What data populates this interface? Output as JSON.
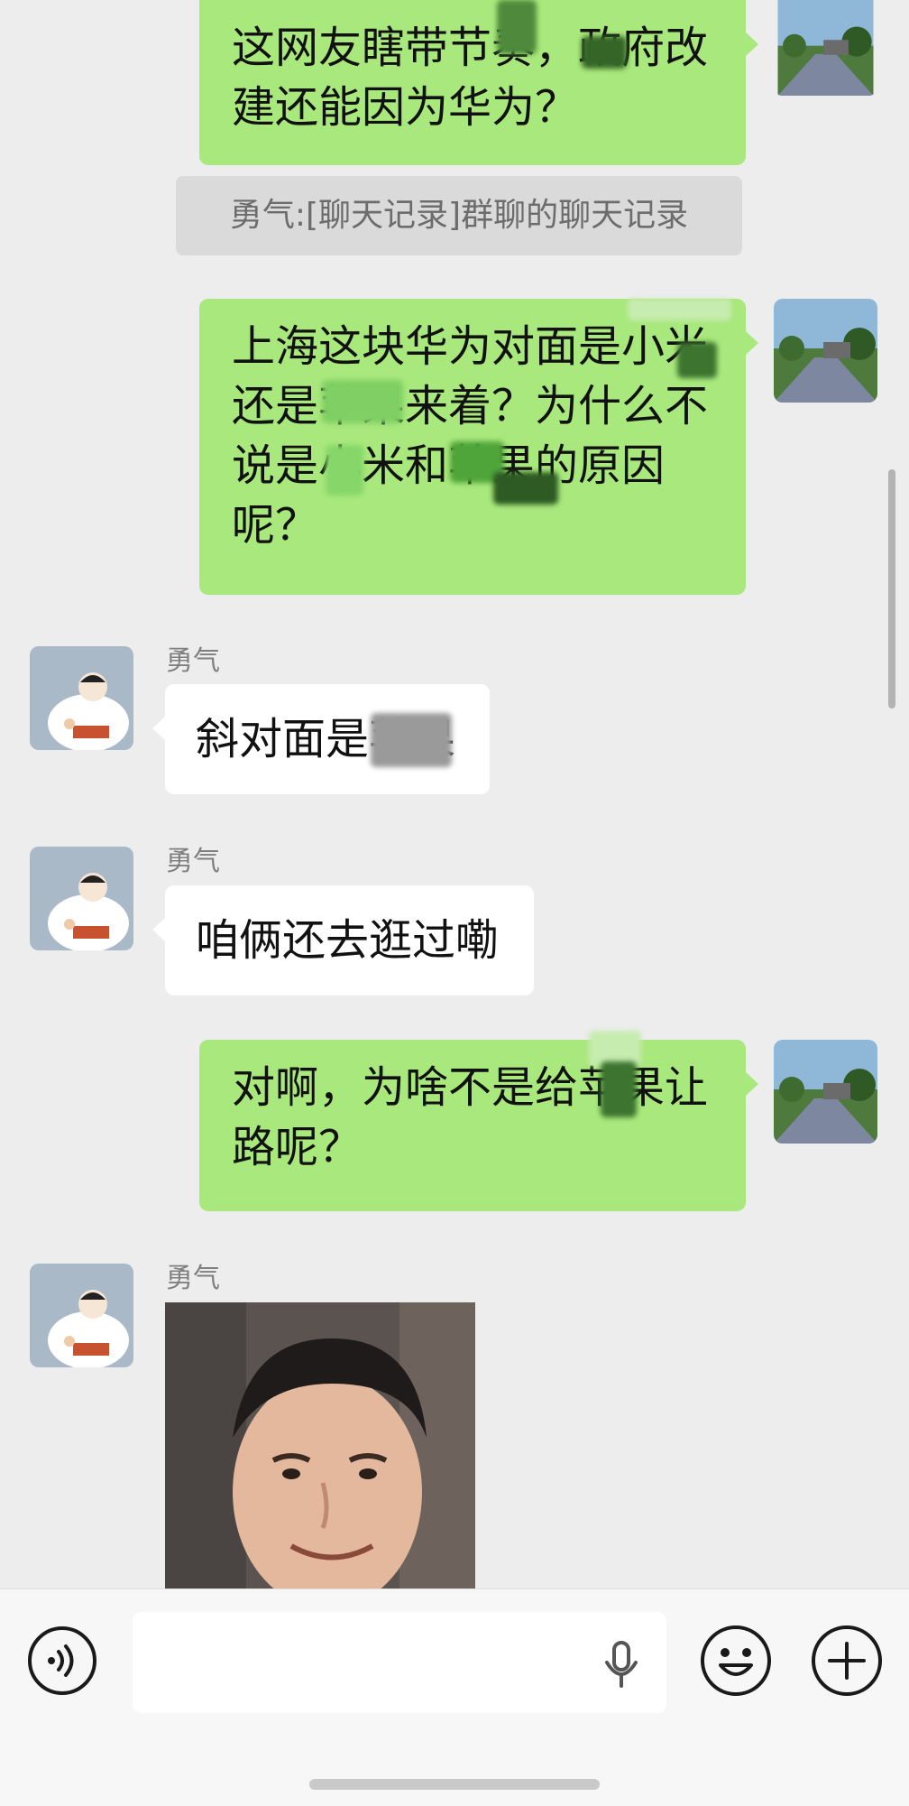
{
  "chat": {
    "messages": [
      {
        "side": "right",
        "text": "这网友瞎带节奏，政府改建还能因为华为？"
      },
      {
        "system": "勇气:[聊天记录]群聊的聊天记录"
      },
      {
        "side": "right",
        "text": "上海这块华为对面是小米还是苹果来着？为什么不说是小米和苹果的原因呢？"
      },
      {
        "side": "left",
        "sender": "勇气",
        "text": "斜对面是苹果"
      },
      {
        "side": "left",
        "sender": "勇气",
        "text": "咱俩还去逛过嘞"
      },
      {
        "side": "right",
        "text": "对啊，为啥不是给苹果让路呢？"
      },
      {
        "side": "left",
        "sender": "勇气",
        "sticker": "smiling-man-sticker"
      }
    ]
  },
  "icons": {
    "voice": "voice-wave-icon",
    "mic": "microphone-icon",
    "emoji": "smiley-icon",
    "plus": "plus-icon"
  },
  "colors": {
    "my_bubble": "#a9e87c",
    "their_bubble": "#ffffff",
    "background": "#ededed"
  }
}
